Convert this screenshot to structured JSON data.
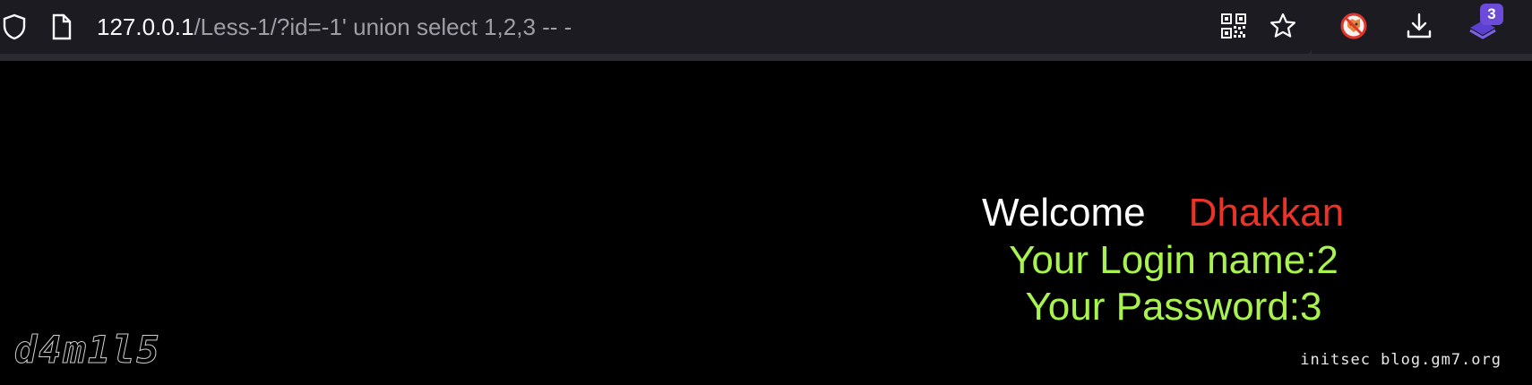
{
  "browser": {
    "url_host": "127.0.0.1",
    "url_rest": "/Less-1/?id=-1' union select 1,2,3 -- -",
    "icons": [
      "shield-icon",
      "page-icon",
      "qr-code-icon",
      "bookmark-star-icon",
      "blocked-extension-icon",
      "download-icon",
      "extension-badge-icon"
    ],
    "extension_badge": "3"
  },
  "page": {
    "welcome_label": "Welcome",
    "welcome_name": "Dhakkan",
    "login_line": "Your Login name:2",
    "password_line": "Your Password:3",
    "logo_text": "d4m1l5",
    "credit": "initsec blog.gm7.org",
    "colors": {
      "welcome": "#ffffff",
      "name": "#ec3328",
      "info": "#a9f350",
      "background": "#000000"
    }
  }
}
